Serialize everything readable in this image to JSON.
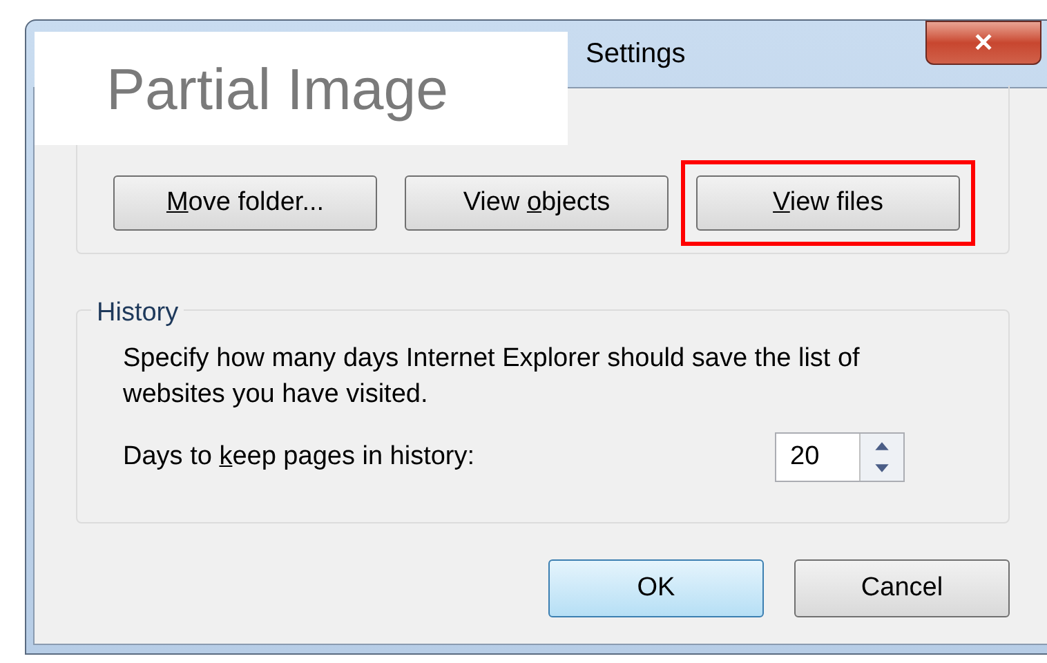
{
  "window": {
    "title": "Settings",
    "close": "✕"
  },
  "overlay_label": "Partial Image",
  "top_buttons": [
    {
      "key": "M",
      "post": "ove folder...",
      "highlighted": false
    },
    {
      "pre": "View ",
      "key": "o",
      "post": "bjects",
      "highlighted": false
    },
    {
      "key": "V",
      "post": "iew files",
      "highlighted": true
    }
  ],
  "history": {
    "title": "History",
    "description": "Specify how many days Internet Explorer should save the list of websites you have visited.",
    "days_label": {
      "pre": "Days to ",
      "key": "k",
      "post": "eep pages in history:"
    },
    "days_value": "20"
  },
  "buttons": [
    {
      "label": "OK",
      "default": true
    },
    {
      "label": "Cancel",
      "default": false
    }
  ]
}
